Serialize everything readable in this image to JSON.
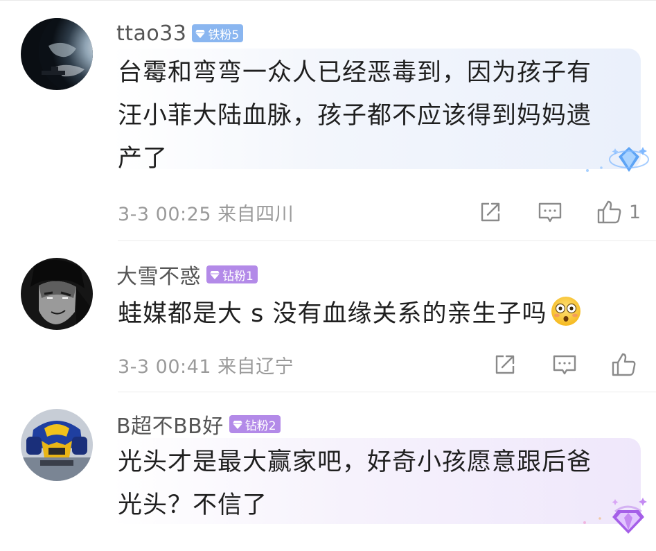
{
  "comments": [
    {
      "username": "ttao33",
      "badge": "铁粉5",
      "badge_color": "#8ab6f0",
      "text_lines": [
        "台霉和弯弯一众人已经恶毒到，因为孩子有",
        "汪小菲大陆血脉，孩子都不应该得到妈妈遗",
        "产了"
      ],
      "meta": "3-3 00:25 来自四川",
      "like_count": "1",
      "bubble_icon": "blue-diamond-icon"
    },
    {
      "username": "大雪不惑",
      "badge": "钻粉1",
      "badge_color": "#b38ae8",
      "text": "蛙媒都是大 s 没有血缘关系的亲生子吗",
      "emoji": "flushed-face-icon",
      "meta": "3-3 00:41 来自辽宁",
      "like_count": ""
    },
    {
      "username": "B超不BB好",
      "badge": "钻粉2",
      "badge_color": "#b38ae8",
      "text_lines": [
        "光头才是最大赢家吧，好奇小孩愿意跟后爸",
        "光头？不信了"
      ],
      "bubble_icon": "purple-diamond-icon"
    }
  ]
}
